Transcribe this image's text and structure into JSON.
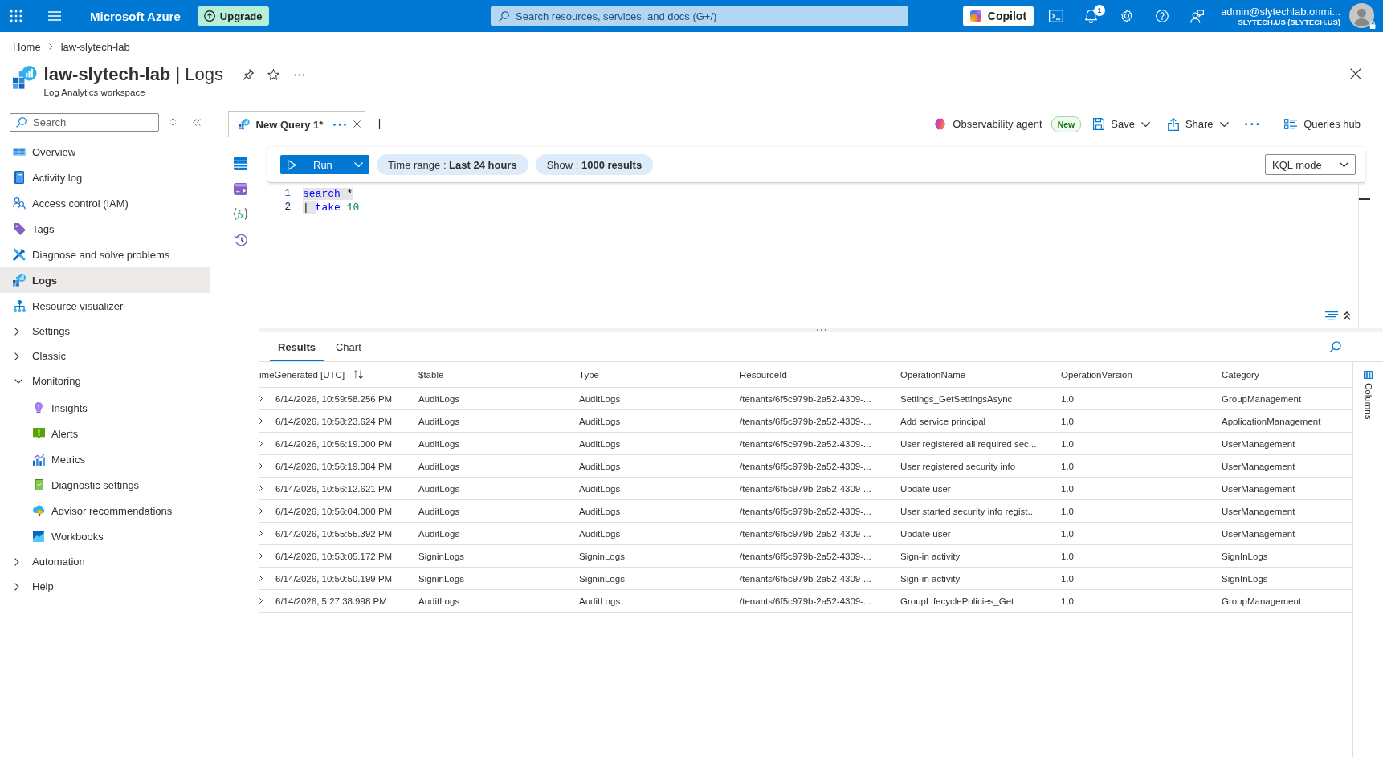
{
  "top_bar": {
    "brand": "Microsoft Azure",
    "upgrade_button": "Upgrade",
    "search": {
      "placeholder": "Search resources, services, and docs (G+/)"
    },
    "copilot_button": "Copilot",
    "notification_count": "1",
    "account": {
      "email": "admin@slytechlab.onmi...",
      "tenant": "SLYTECH.US (SLYTECH.US)"
    }
  },
  "breadcrumb": [
    {
      "label": "Home"
    },
    {
      "label": "law-slytech-lab"
    }
  ],
  "page_header": {
    "title": "**law-slytech-lab** | Logs",
    "subtitle": "Log Analytics workspace"
  },
  "sidebar": {
    "search": {
      "placeholder": "Search"
    },
    "items": [
      {
        "kind": "link",
        "label": "Overview",
        "selected": false
      },
      {
        "kind": "link",
        "label": "Activity log",
        "selected": false
      },
      {
        "kind": "link",
        "label": "Access control (IAM)",
        "selected": false
      },
      {
        "kind": "link",
        "label": "Tags",
        "selected": false
      },
      {
        "kind": "link",
        "label": "Diagnose and solve problems",
        "selected": false
      },
      {
        "kind": "link",
        "label": "Logs",
        "selected": true
      },
      {
        "kind": "link",
        "label": "Resource visualizer",
        "selected": false
      },
      {
        "kind": "group",
        "label": "Settings",
        "expanded": false
      },
      {
        "kind": "group",
        "label": "Classic",
        "expanded": false
      },
      {
        "kind": "group",
        "label": "Monitoring",
        "expanded": true,
        "children": [
          {
            "kind": "link",
            "label": "Insights",
            "selected": false
          },
          {
            "kind": "link",
            "label": "Alerts",
            "selected": false
          },
          {
            "kind": "link",
            "label": "Metrics",
            "selected": false
          },
          {
            "kind": "link",
            "label": "Diagnostic settings",
            "selected": false
          },
          {
            "kind": "link",
            "label": "Advisor recommendations",
            "selected": false
          },
          {
            "kind": "link",
            "label": "Workbooks",
            "selected": false
          }
        ]
      },
      {
        "kind": "group",
        "label": "Automation",
        "expanded": false
      },
      {
        "kind": "group",
        "label": "Help",
        "expanded": false
      }
    ]
  },
  "query_tabs": [
    {
      "label": "New Query 1*",
      "selected": true
    }
  ],
  "toolbar": {
    "agent_button": "Observability agent",
    "agent_badge": "New",
    "save_button": "Save",
    "share_button": "Share",
    "queries_hub_button": "Queries hub"
  },
  "query_bar": {
    "run_button": "Run",
    "time_range": "Time range : **Last 24 hours**",
    "result_limit": "Show : **1000 results**",
    "mode_dropdown": "KQL mode"
  },
  "editor": {
    "lines": [
      {
        "number": "1",
        "active": false,
        "tokens": [
          {
            "kind": "keyword",
            "text": "search",
            "highlighted": true
          },
          {
            "kind": "plain",
            "text": " *",
            "highlighted": true
          }
        ]
      },
      {
        "number": "2",
        "active": true,
        "tokens": [
          {
            "kind": "plain",
            "text": "| ",
            "highlighted": true
          },
          {
            "kind": "keyword",
            "text": "take",
            "highlighted": false
          },
          {
            "kind": "number",
            "text": " 10",
            "highlighted": false
          }
        ]
      }
    ]
  },
  "results_tabs": [
    {
      "label": "Results",
      "selected": true
    },
    {
      "label": "Chart",
      "selected": false
    }
  ],
  "table": {
    "columns": [
      {
        "label": "imeGenerated [UTC]",
        "sorted": true
      },
      {
        "label": "$table",
        "sorted": false
      },
      {
        "label": "Type",
        "sorted": false
      },
      {
        "label": "ResourceId",
        "sorted": false
      },
      {
        "label": "OperationName",
        "sorted": false
      },
      {
        "label": "OperationVersion",
        "sorted": false
      },
      {
        "label": "Category",
        "sorted": false
      }
    ],
    "rows": [
      {
        "expanded": false,
        "cells": [
          "6/14/2026, 10:59:58.256 PM",
          "AuditLogs",
          "AuditLogs",
          "/tenants/6f5c979b-2a52-4309-...",
          "Settings_GetSettingsAsync",
          "1.0",
          "GroupManagement"
        ]
      },
      {
        "expanded": false,
        "cells": [
          "6/14/2026, 10:58:23.624 PM",
          "AuditLogs",
          "AuditLogs",
          "/tenants/6f5c979b-2a52-4309-...",
          "Add service principal",
          "1.0",
          "ApplicationManagement"
        ]
      },
      {
        "expanded": false,
        "cells": [
          "6/14/2026, 10:56:19.000 PM",
          "AuditLogs",
          "AuditLogs",
          "/tenants/6f5c979b-2a52-4309-...",
          "User registered all required sec...",
          "1.0",
          "UserManagement"
        ]
      },
      {
        "expanded": false,
        "cells": [
          "6/14/2026, 10:56:19.084 PM",
          "AuditLogs",
          "AuditLogs",
          "/tenants/6f5c979b-2a52-4309-...",
          "User registered security info",
          "1.0",
          "UserManagement"
        ]
      },
      {
        "expanded": false,
        "cells": [
          "6/14/2026, 10:56:12.621 PM",
          "AuditLogs",
          "AuditLogs",
          "/tenants/6f5c979b-2a52-4309-...",
          "Update user",
          "1.0",
          "UserManagement"
        ]
      },
      {
        "expanded": false,
        "cells": [
          "6/14/2026, 10:56:04.000 PM",
          "AuditLogs",
          "AuditLogs",
          "/tenants/6f5c979b-2a52-4309-...",
          "User started security info regist...",
          "1.0",
          "UserManagement"
        ]
      },
      {
        "expanded": false,
        "cells": [
          "6/14/2026, 10:55:55.392 PM",
          "AuditLogs",
          "AuditLogs",
          "/tenants/6f5c979b-2a52-4309-...",
          "Update user",
          "1.0",
          "UserManagement"
        ]
      },
      {
        "expanded": false,
        "cells": [
          "6/14/2026, 10:53:05.172 PM",
          "SigninLogs",
          "SigninLogs",
          "/tenants/6f5c979b-2a52-4309-...",
          "Sign-in activity",
          "1.0",
          "SignInLogs"
        ]
      },
      {
        "expanded": false,
        "cells": [
          "6/14/2026, 10:50:50.199 PM",
          "SigninLogs",
          "SigninLogs",
          "/tenants/6f5c979b-2a52-4309-...",
          "Sign-in activity",
          "1.0",
          "SignInLogs"
        ]
      },
      {
        "expanded": false,
        "cells": [
          "6/14/2026, 5:27:38.998 PM",
          "AuditLogs",
          "AuditLogs",
          "/tenants/6f5c979b-2a52-4309-...",
          "GroupLifecyclePolicies_Get",
          "1.0",
          "GroupManagement"
        ]
      }
    ]
  },
  "columns_panel": {
    "label": "Columns"
  }
}
